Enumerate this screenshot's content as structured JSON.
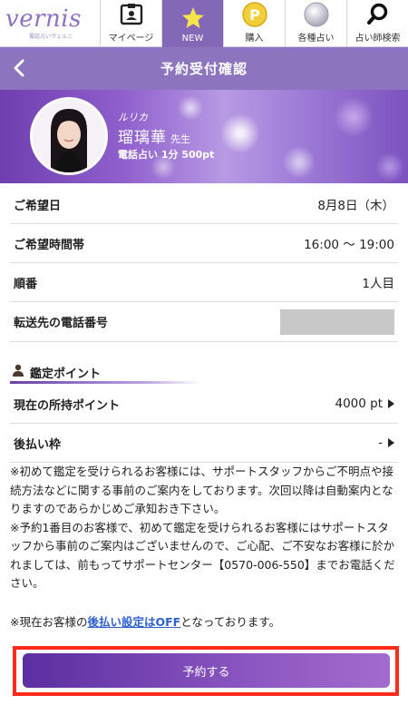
{
  "logo": {
    "brand": "vernis",
    "tagline": "電話占いヴェルニ"
  },
  "nav": [
    {
      "label": "マイページ",
      "icon": "id-card-icon",
      "active": false
    },
    {
      "label": "NEW",
      "icon": "star-icon",
      "active": true
    },
    {
      "label": "購入",
      "icon": "point-coin-icon",
      "active": false
    },
    {
      "label": "各種占い",
      "icon": "crystal-ball-icon",
      "active": false
    },
    {
      "label": "占い師検索",
      "icon": "search-icon",
      "active": false
    }
  ],
  "header": {
    "title": "予約受付確認",
    "back_icon": "chevron-left-icon"
  },
  "profile": {
    "kana": "ルリカ",
    "name": "瑠璃華",
    "suffix": "先生",
    "rate": "電話占い 1分 500pt"
  },
  "booking": {
    "date_label": "ご希望日",
    "date_value": "8月8日（木）",
    "time_label": "ご希望時間帯",
    "time_value": "16:00 〜 19:00",
    "order_label": "順番",
    "order_value": "1人目",
    "phone_label": "転送先の電話番号"
  },
  "points": {
    "section_title": "鑑定ポイント",
    "current_label": "現在の所持ポイント",
    "current_value": "4000 pt",
    "deferred_label": "後払い枠",
    "deferred_value": "-"
  },
  "notes": {
    "line1": "※初めて鑑定を受けられるお客様には、サポートスタッフからご不明点や接続方法などに関する事前のご案内をしております。次回以降は自動案内となりますのであらかじめご承知おき下さい。",
    "line2": "※予約1番目のお客様で、初めて鑑定を受けられるお客様にはサポートスタッフから事前のご案内はございませんので、ご心配、ご不安なお客様に於かれましては、前もってサポートセンター【0570-006-550】までお電話ください。",
    "line3_prefix": "※現在お客様の",
    "line3_link": "後払い設定はOFF",
    "line3_suffix": "となっております。"
  },
  "actions": {
    "reserve_label": "予約する"
  },
  "colors": {
    "accent": "#8c74bf",
    "nav_active": "#8468b8",
    "highlight_border": "#ff2a1a",
    "link": "#2b5fd0"
  }
}
